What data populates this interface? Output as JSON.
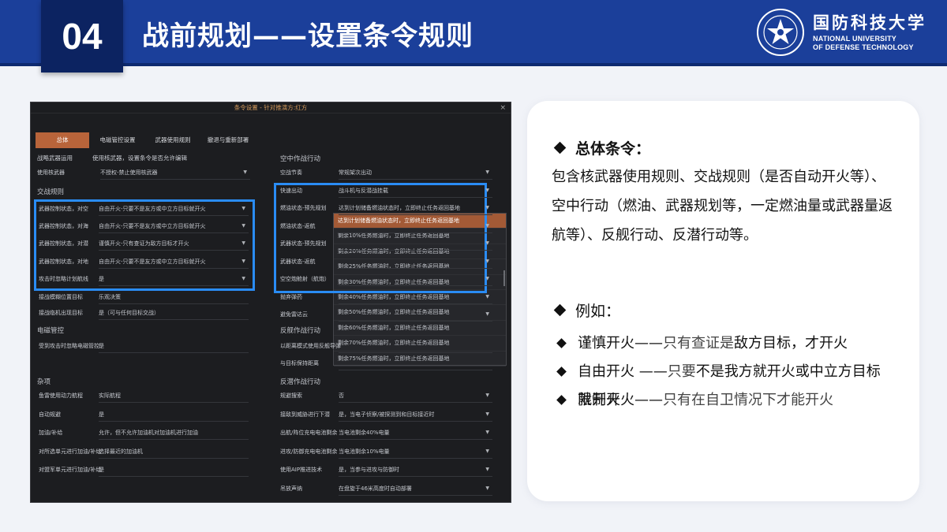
{
  "header": {
    "number": "04",
    "title": "战前规划——设置条令规则",
    "university_cn": "国防科技大学",
    "university_en_line1": "NATIONAL UNIVERSITY",
    "university_en_line2": "OF DEFENSE TECHNOLOGY",
    "accent_color": "#1b3f9a"
  },
  "dialog": {
    "title": "条令设置 - 针对推演方:红方",
    "close": "×",
    "tabs": [
      "总体",
      "电磁管控设置",
      "武器使用规则",
      "撤退与重新部署"
    ],
    "left": {
      "strategic_weapon_label": "战略武器运用",
      "strategic_weapon_desc": "使用核武器，设置条令是否允许编辑",
      "nuclear_label": "使用核武器",
      "nuclear_value": "不授权-禁止使用核武器",
      "engagement_section": "交战规则",
      "engagement_rows": [
        {
          "label": "武器控制状态，对空",
          "value": "自由开火-只要不是友方或中立方目标就开火"
        },
        {
          "label": "武器控制状态，对海",
          "value": "自由开火-只要不是友方或中立方目标就开火"
        },
        {
          "label": "武器控制状态，对潜",
          "value": "谨慎开火-只有查证为敌方目标才开火"
        },
        {
          "label": "武器控制状态，对地",
          "value": "自由开火-只要不是友方或中立方目标就开火"
        },
        {
          "label": "攻击时忽略计划航线",
          "value": "是"
        }
      ],
      "extra_rows": [
        {
          "label": "接战模糊位置目标",
          "value": "乐观决策"
        },
        {
          "label": "接战临机出现目标",
          "value": "是（可与任何目标交战）"
        }
      ],
      "emcon_section": "电磁管控",
      "emcon_rows": [
        {
          "label": "受到攻击时忽略电磁管控",
          "value": "是"
        }
      ],
      "misc_section": "杂项",
      "misc_rows": [
        {
          "label": "鱼雷使用动力航程",
          "value": "实际航程"
        },
        {
          "label": "自动规避",
          "value": "是"
        },
        {
          "label": "加油/补给",
          "value": "允许，但不允许加油机对加油机进行加油"
        },
        {
          "label": "对所选单元进行加油/补给",
          "value": "选择最近的加油机"
        },
        {
          "label": "对盟军单元进行加油/补给",
          "value": "是"
        }
      ]
    },
    "right": {
      "air_section": "空中作战行动",
      "air_rows": [
        {
          "label": "空战节奏",
          "value": "常规架次出动"
        },
        {
          "label": "快速出动",
          "value": "战斗机与反潜战挂载"
        },
        {
          "label": "燃油状态-预先规划",
          "value": "达到计划储备燃油状态时，立即终止任务返回基地"
        },
        {
          "label": "燃油状态-返航",
          "value": ""
        },
        {
          "label": "武器状态-预先规划",
          "value": ""
        },
        {
          "label": "武器状态-返航",
          "value": ""
        },
        {
          "label": "空空炮舱射（航炮）",
          "value": ""
        },
        {
          "label": "抛弃弹药",
          "value": ""
        },
        {
          "label": "避免雷达云",
          "value": ""
        }
      ],
      "fuel_options": [
        "达到计划储备燃油状态时，立即终止任务返回基地",
        "剩余10%任务燃油时，立即终止任务返回基地",
        "剩余20%任务燃油时，立即终止任务返回基地",
        "剩余25%任务燃油时，立即终止任务返回基地",
        "剩余30%任务燃油时，立即终止任务返回基地",
        "剩余40%任务燃油时，立即终止任务返回基地",
        "剩余50%任务燃油时，立即终止任务返回基地",
        "剩余60%任务燃油时，立即终止任务返回基地",
        "剩余70%任务燃油时，立即终止任务返回基地",
        "剩余75%任务燃油时，立即终止任务返回基地"
      ],
      "anti_ship_section": "反舰作战行动",
      "anti_ship_rows": [
        {
          "label": "以距离模式使用反舰导弹",
          "value": ""
        },
        {
          "label": "与目标保持距离",
          "value": ""
        }
      ],
      "asw_section": "反潜作战行动",
      "asw_rows": [
        {
          "label": "规避搜索",
          "value": "否"
        },
        {
          "label": "接敌到威胁进行下潜",
          "value": "是，当电子侦察/被探测到和目标接近时"
        },
        {
          "label": "出航/阵位充电电池剩余",
          "value": "当电池剩余40%电量"
        },
        {
          "label": "进攻/防御充电电池剩余",
          "value": "当电池剩余10%电量"
        },
        {
          "label": "使用AIP推进技术",
          "value": "是，当参与进攻与防御时"
        },
        {
          "label": "吊放声纳",
          "value": "在盘旋于46米高度时自动部署"
        }
      ]
    }
  },
  "card": {
    "heading": "总体条令：",
    "paragraph": "包含核武器使用规则、交战规则（是否自动开火等）、空中行动（燃油、武器规划等，一定燃油量或武器量返航等）、反舰行动、反潜行动等。",
    "example_heading": "例如：",
    "examples": [
      {
        "term": "谨慎开火——",
        "desc": "只有查证是",
        "rest": "敌方目标，才开火"
      },
      {
        "term": "自由开火 ——",
        "desc": "只要",
        "rest": "不是我方就开火或中立方目标就开火"
      },
      {
        "term": "限制开火——",
        "desc": "只有在自卫情况下才能开火",
        "rest": ""
      }
    ]
  }
}
